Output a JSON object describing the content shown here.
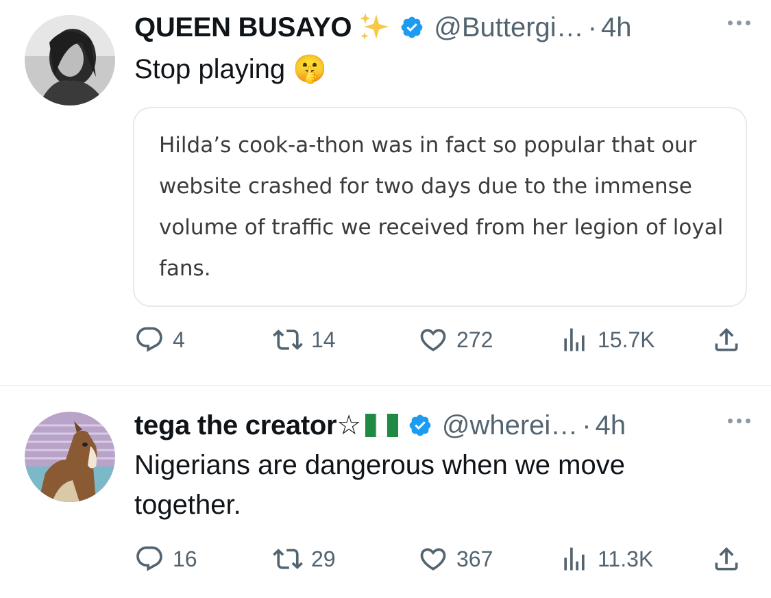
{
  "tweets": [
    {
      "name": "QUEEN BUSAYO",
      "name_emoji": "sparkles-icon",
      "handle": "@Buttergi…",
      "dot": "·",
      "time": "4h",
      "text": "Stop playing 🤫",
      "quote_text": "Hilda’s cook-a-thon was in fact so popular that our website crashed for two days due to the immense volume of traffic we received from her legion of loyal fans.",
      "actions": {
        "replies": "4",
        "retweets": "14",
        "likes": "272",
        "views": "15.7K"
      }
    },
    {
      "name": "tega the creator☆",
      "name_emoji": "nigeria-flag-icon",
      "handle": "@wherei…",
      "dot": "·",
      "time": "4h",
      "text": "Nigerians are dangerous when we move together.",
      "actions": {
        "replies": "16",
        "retweets": "29",
        "likes": "367",
        "views": "11.3K"
      }
    }
  ],
  "colors": {
    "verified": "#1d9bf0",
    "secondary_text": "#536471",
    "border": "#e7e9ea"
  }
}
